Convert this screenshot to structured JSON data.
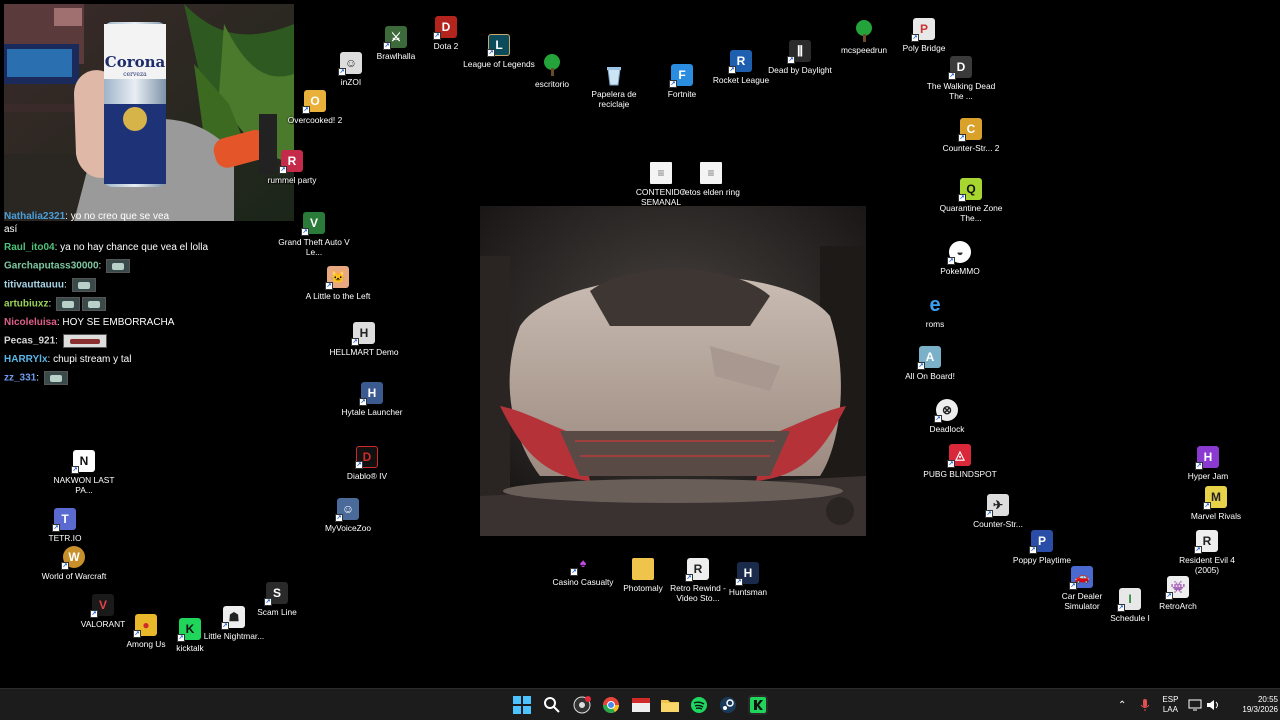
{
  "chat": {
    "partial_user": "Nathalia2321",
    "partial_text": "yo no creo que se vea",
    "partial_cont": "así",
    "messages": [
      {
        "user": "Raul_ito04",
        "color": "#4ec27a",
        "text": "ya no hay chance que vea el lolla"
      },
      {
        "user": "Garchaputass30000",
        "color": "#7ec8a0",
        "text": ""
      },
      {
        "user": "titivauttauuu",
        "color": "#a7d3e6",
        "text": ""
      },
      {
        "user": "artubiuxz",
        "color": "#9ad35a",
        "text": ""
      },
      {
        "user": "Nicoleluisa",
        "color": "#e05f8a",
        "text": "HOY SE EMBORRACHA"
      },
      {
        "user": "Pecas_921",
        "color": "#d8d8d8",
        "text": ""
      },
      {
        "user": "HARRYlx",
        "color": "#5ab6e6",
        "text": "chupi stream y tal"
      },
      {
        "user": "zz_331",
        "color": "#6f9cf0",
        "text": ""
      }
    ]
  },
  "webcam": {
    "can_brand": "Corona",
    "can_sub": "cerveza"
  },
  "icons": {
    "brawlhalla": "Brawlhalla",
    "dota2": "Dota 2",
    "lol": "League of Legends",
    "escritorio": "escritorio",
    "papelera": "Papelera de reciclaje",
    "fortnite": "Fortnite",
    "rocket": "Rocket League",
    "dbd": "Dead by Daylight",
    "mcspeedrun": "mcspeedrun",
    "polybridge": "Poly Bridge",
    "inzoi": "inZOI",
    "overcooked": "Overcooked! 2",
    "rummel": "rummel party",
    "twd": "The Walking Dead The ...",
    "cs2": "Counter-Str... 2",
    "qz": "Quarantine Zone The...",
    "pokemmo": "PokeMMO",
    "roms": "roms",
    "allonboard": "All On Board!",
    "deadlock": "Deadlock",
    "pubg": "PUBG BLINDSPOT",
    "cs": "Counter-Str...",
    "poppy": "Poppy Playtime",
    "cardealer": "Car Dealer Simulator",
    "schedule": "Schedule I",
    "retroarch": "RetroArch",
    "hyperjam": "Hyper Jam",
    "marvel": "Marvel Rivals",
    "re4": "Resident Evil 4 (2005)",
    "contenido": "CONTENIDO SEMANAL",
    "retos": "retos elden ring",
    "gta": "Grand Theft Auto V Le...",
    "alittle": "A Little to the Left",
    "hellmart": "HELLMART Demo",
    "hytale": "Hytale Launcher",
    "diablo": "Diablo® IV",
    "myvoice": "MyVoiceZoo",
    "nakwon": "NAKWON LAST PA...",
    "tetrio": "TETR.IO",
    "wow": "World of Warcraft",
    "valorant": "VALORANT",
    "amongus": "Among Us",
    "kicktalk": "kicktalk",
    "littlenight": "Little Nightmar...",
    "scamline": "Scam Line",
    "casino": "Casino Casualty",
    "photomaly": "Photomaly",
    "retrorewind": "Retro Rewind - Video Sto...",
    "huntsman": "Huntsman"
  },
  "tray": {
    "lang1": "ESP",
    "lang2": "LAA",
    "time": "20:55",
    "date": "19/3/2026"
  }
}
